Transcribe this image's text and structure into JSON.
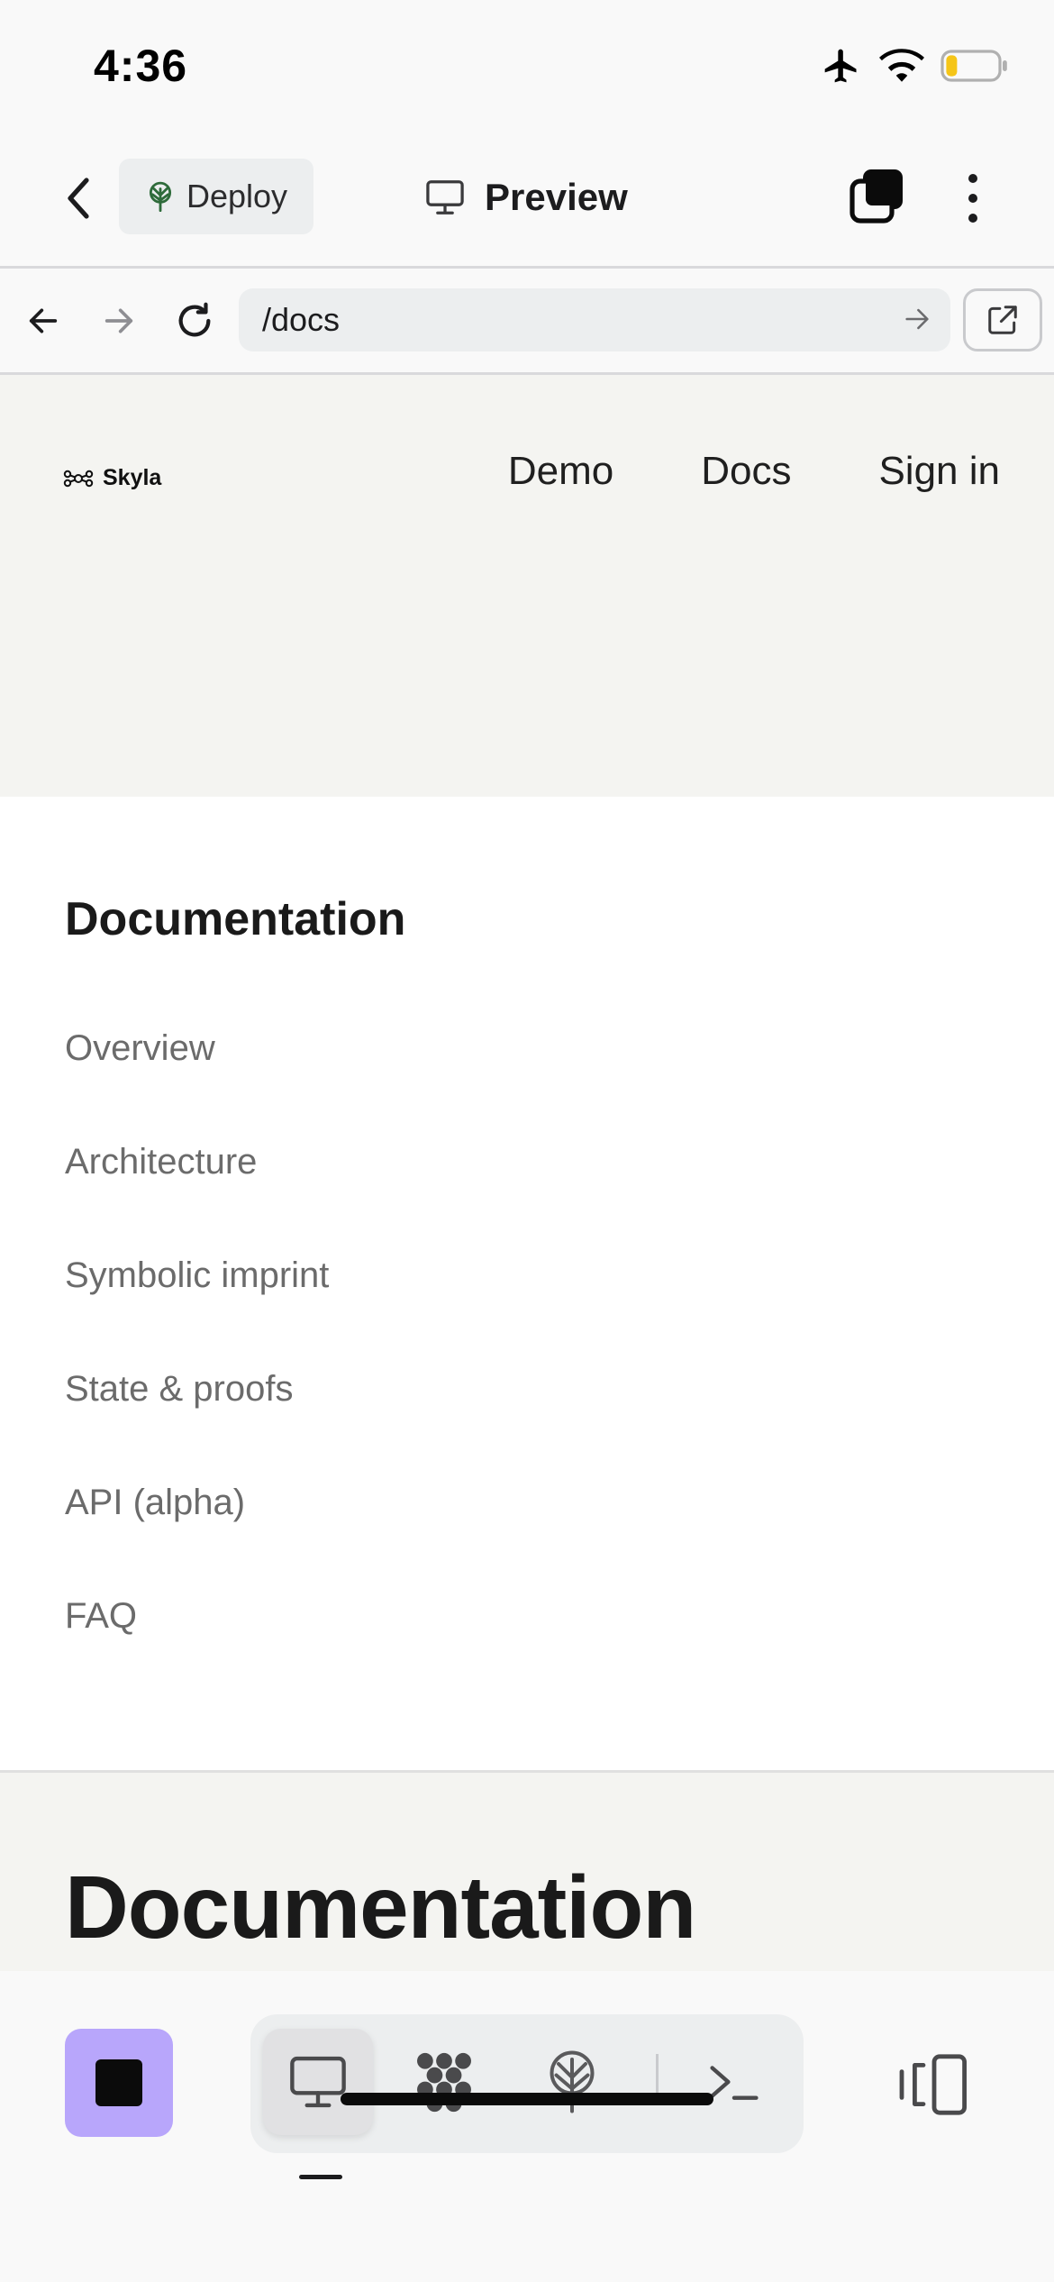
{
  "status_bar": {
    "time": "4:36",
    "icons": [
      "airplane-icon",
      "wifi-icon",
      "battery-icon"
    ],
    "battery_level": 0.2
  },
  "app_header": {
    "back_icon": "chevron-left-icon",
    "deploy_label": "Deploy",
    "deploy_icon": "tree-icon",
    "preview_label": "Preview",
    "preview_icon": "monitor-icon",
    "tabs_icon": "stacked-squares-icon",
    "more_icon": "more-vertical-icon"
  },
  "browser": {
    "back_icon": "arrow-left-icon",
    "forward_icon": "arrow-right-icon",
    "reload_icon": "reload-icon",
    "url": "/docs",
    "go_icon": "arrow-right-icon",
    "open_external_icon": "external-link-icon"
  },
  "site": {
    "logo_text": "Skyla",
    "nav": [
      "Demo",
      "Docs",
      "Sign in"
    ],
    "sidebar_heading": "Documentation",
    "doc_links": [
      "Overview",
      "Architecture",
      "Symbolic imprint",
      "State & proofs",
      "API (alpha)",
      "FAQ"
    ],
    "hero_title": "Documentation"
  },
  "bottom_toolbar": {
    "stop_icon": "stop-icon",
    "tabs": [
      {
        "icon": "monitor-icon",
        "active": true
      },
      {
        "icon": "molecule-icon",
        "active": false
      },
      {
        "icon": "tree-icon",
        "active": false
      },
      {
        "icon": "terminal-icon",
        "active": false
      }
    ],
    "layout_icon": "split-view-icon"
  },
  "colors": {
    "accent_purple": "#b8a6fb",
    "chrome_bg": "#f9f9f9",
    "site_bg": "#f4f4f1",
    "pill_bg": "#eceeef",
    "deploy_green": "#2e6b3a",
    "battery_yellow": "#f5c518"
  }
}
